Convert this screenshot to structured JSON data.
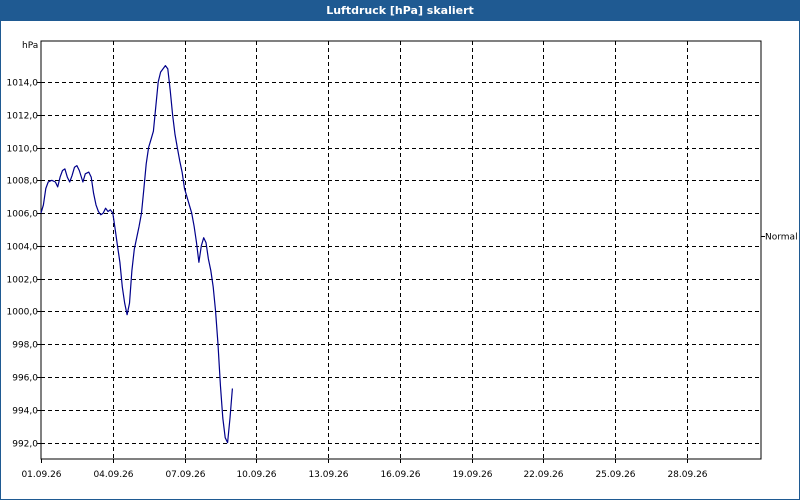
{
  "window": {
    "title": "Luftdruck [hPa] skaliert"
  },
  "chart_data": {
    "type": "line",
    "title": "Luftdruck [hPa] skaliert",
    "ylabel": "hPa",
    "xlabel": "",
    "ylim": [
      991.0,
      1016.5
    ],
    "xlim": [
      0,
      30.1
    ],
    "y_ticks": [
      "992,0",
      "994,0",
      "996,0",
      "998,0",
      "1000,0",
      "1002,0",
      "1004,0",
      "1006,0",
      "1008,0",
      "1010,0",
      "1012,0",
      "1014,0"
    ],
    "y_tick_values": [
      992,
      994,
      996,
      998,
      1000,
      1002,
      1004,
      1006,
      1008,
      1010,
      1012,
      1014
    ],
    "x_ticks": [
      "01.09.26",
      "04.09.26",
      "07.09.26",
      "10.09.26",
      "13.09.26",
      "16.09.26",
      "19.09.26",
      "22.09.26",
      "25.09.26",
      "28.09.26"
    ],
    "x_tick_values": [
      0,
      3,
      6,
      9,
      12,
      15,
      18,
      21,
      24,
      27
    ],
    "annotation": {
      "label": "Normal",
      "y": 1004.6
    },
    "grid": true,
    "colors": {
      "series": "#00008b",
      "title_bar": "#1f5a92",
      "grid": "#000000"
    },
    "series": [
      {
        "points": [
          [
            0.0,
            1006.0
          ],
          [
            0.1,
            1006.5
          ],
          [
            0.2,
            1007.5
          ],
          [
            0.3,
            1007.9
          ],
          [
            0.45,
            1008.0
          ],
          [
            0.6,
            1007.9
          ],
          [
            0.7,
            1007.6
          ],
          [
            0.8,
            1008.2
          ],
          [
            0.9,
            1008.6
          ],
          [
            1.0,
            1008.7
          ],
          [
            1.1,
            1008.2
          ],
          [
            1.2,
            1007.9
          ],
          [
            1.3,
            1008.3
          ],
          [
            1.4,
            1008.8
          ],
          [
            1.5,
            1008.9
          ],
          [
            1.6,
            1008.6
          ],
          [
            1.75,
            1007.9
          ],
          [
            1.85,
            1008.4
          ],
          [
            2.0,
            1008.5
          ],
          [
            2.1,
            1008.2
          ],
          [
            2.2,
            1007.2
          ],
          [
            2.3,
            1006.5
          ],
          [
            2.4,
            1006.1
          ],
          [
            2.5,
            1005.9
          ],
          [
            2.6,
            1006.0
          ],
          [
            2.7,
            1006.3
          ],
          [
            2.8,
            1006.1
          ],
          [
            2.9,
            1006.2
          ],
          [
            3.0,
            1006.0
          ],
          [
            3.1,
            1005.0
          ],
          [
            3.2,
            1004.0
          ],
          [
            3.3,
            1003.0
          ],
          [
            3.4,
            1001.5
          ],
          [
            3.5,
            1000.5
          ],
          [
            3.6,
            999.8
          ],
          [
            3.7,
            1000.5
          ],
          [
            3.8,
            1002.5
          ],
          [
            3.9,
            1003.8
          ],
          [
            4.0,
            1004.5
          ],
          [
            4.1,
            1005.2
          ],
          [
            4.2,
            1006.0
          ],
          [
            4.3,
            1007.5
          ],
          [
            4.4,
            1009.0
          ],
          [
            4.5,
            1010.0
          ],
          [
            4.6,
            1010.5
          ],
          [
            4.7,
            1011.0
          ],
          [
            4.8,
            1012.5
          ],
          [
            4.9,
            1014.0
          ],
          [
            5.0,
            1014.6
          ],
          [
            5.1,
            1014.8
          ],
          [
            5.2,
            1015.0
          ],
          [
            5.3,
            1014.8
          ],
          [
            5.4,
            1013.5
          ],
          [
            5.5,
            1012.0
          ],
          [
            5.6,
            1010.8
          ],
          [
            5.7,
            1010.0
          ],
          [
            5.8,
            1009.2
          ],
          [
            5.9,
            1008.5
          ],
          [
            6.0,
            1007.5
          ],
          [
            6.1,
            1007.0
          ],
          [
            6.2,
            1006.5
          ],
          [
            6.3,
            1006.0
          ],
          [
            6.4,
            1005.2
          ],
          [
            6.5,
            1004.2
          ],
          [
            6.6,
            1003.0
          ],
          [
            6.7,
            1004.0
          ],
          [
            6.8,
            1004.5
          ],
          [
            6.9,
            1004.2
          ],
          [
            7.0,
            1003.2
          ],
          [
            7.1,
            1002.5
          ],
          [
            7.2,
            1001.5
          ],
          [
            7.3,
            1000.0
          ],
          [
            7.4,
            998.0
          ],
          [
            7.5,
            995.5
          ],
          [
            7.6,
            993.5
          ],
          [
            7.7,
            992.3
          ],
          [
            7.8,
            992.0
          ],
          [
            7.9,
            993.5
          ],
          [
            8.0,
            995.3
          ]
        ]
      }
    ]
  }
}
